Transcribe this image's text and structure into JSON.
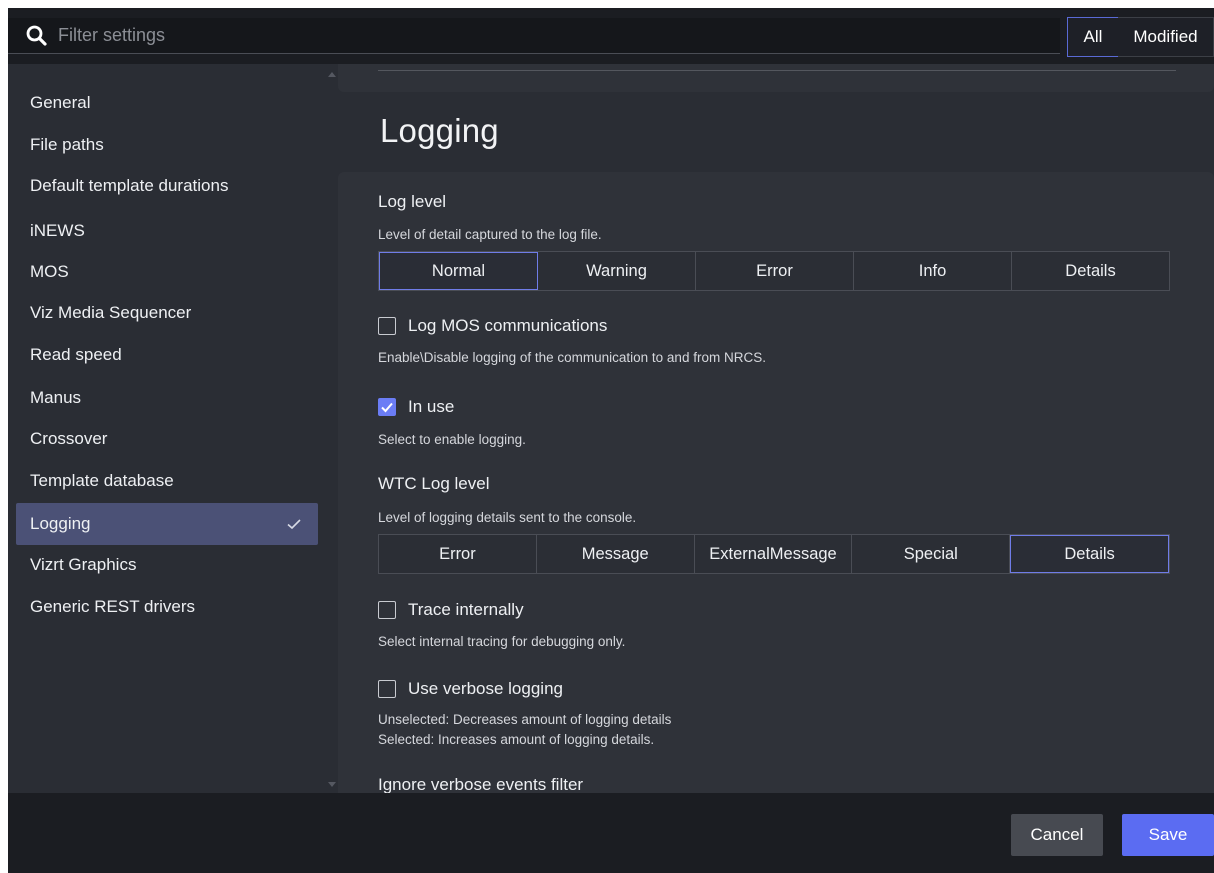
{
  "search": {
    "placeholder": "Filter settings",
    "value": ""
  },
  "filter_tabs": {
    "all": "All",
    "modified": "Modified",
    "selected": "All"
  },
  "sidebar": {
    "items": [
      {
        "label": "General"
      },
      {
        "label": "File paths"
      },
      {
        "label": "Default template durations"
      },
      {
        "label": "iNEWS"
      },
      {
        "label": "MOS"
      },
      {
        "label": "Viz Media Sequencer"
      },
      {
        "label": "Read speed"
      },
      {
        "label": "Manus"
      },
      {
        "label": "Crossover"
      },
      {
        "label": "Template database"
      },
      {
        "label": "Logging"
      },
      {
        "label": "Vizrt Graphics"
      },
      {
        "label": "Generic REST drivers"
      }
    ],
    "active": "Logging"
  },
  "main": {
    "title": "Logging",
    "log_level": {
      "title": "Log level",
      "description": "Level of detail captured to the log file.",
      "options": [
        "Normal",
        "Warning",
        "Error",
        "Info",
        "Details"
      ],
      "selected": "Normal"
    },
    "log_mos": {
      "label": "Log MOS communications",
      "checked": false,
      "description": "Enable\\Disable logging of the communication to and from NRCS."
    },
    "in_use": {
      "label": "In use",
      "checked": true,
      "description": "Select to enable logging."
    },
    "wtc_log_level": {
      "title": "WTC Log level",
      "description": "Level of logging details sent to the console.",
      "options": [
        "Error",
        "Message",
        "ExternalMessage",
        "Special",
        "Details"
      ],
      "selected": "Details"
    },
    "trace_internally": {
      "label": "Trace internally",
      "checked": false,
      "description": "Select internal tracing for debugging only."
    },
    "verbose_logging": {
      "label": "Use verbose logging",
      "checked": false,
      "description_line1": "Unselected: Decreases amount of logging details",
      "description_line2": "Selected: Increases amount of logging details."
    },
    "ignore_verbose_title": "Ignore verbose events filter"
  },
  "footer": {
    "cancel_label": "Cancel",
    "save_label": "Save"
  },
  "colors": {
    "accent": "#5b6cf2",
    "active_nav": "#4b5176",
    "background": "#2a2d34",
    "card": "#2f3239"
  }
}
